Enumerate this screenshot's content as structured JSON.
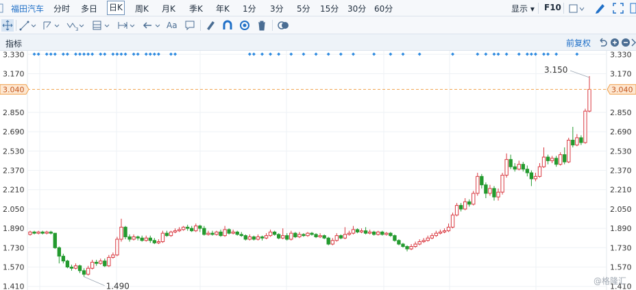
{
  "toolbar": {
    "stock_name": "福田汽车",
    "periods": [
      "分时",
      "多日",
      "日K",
      "周K",
      "月K",
      "季K",
      "年K",
      "1分",
      "3分",
      "5分",
      "15分",
      "30分",
      "60分"
    ],
    "selected_period": "日K",
    "display_label": "显示",
    "f10_label": "F10",
    "text_tool": "Aa"
  },
  "indicator_bar": {
    "label": "指标",
    "adjust_label": "前复权"
  },
  "colors": {
    "up": "#d9363e",
    "down": "#239a2e",
    "accent": "#1f6fc7",
    "price_line": "#f0a04b",
    "marker": "#2f8be0"
  },
  "watermark": "@格隆汇",
  "chart_data": {
    "type": "candlestick",
    "title": "",
    "y_ticks": [
      "3.330",
      "3.170",
      "3.040",
      "2.850",
      "2.690",
      "2.530",
      "2.370",
      "2.210",
      "2.050",
      "1.890",
      "1.730",
      "1.570",
      "1.410"
    ],
    "ylim": [
      1.38,
      3.36
    ],
    "current_price": "3.040",
    "annotations": {
      "max": "3.150",
      "min": "1.490"
    },
    "candles": [
      [
        1.84,
        1.86,
        1.87,
        1.83
      ],
      [
        1.86,
        1.85,
        1.87,
        1.84
      ],
      [
        1.85,
        1.86,
        1.87,
        1.84
      ],
      [
        1.86,
        1.85,
        1.87,
        1.84
      ],
      [
        1.85,
        1.86,
        1.87,
        1.84
      ],
      [
        1.86,
        1.85,
        1.87,
        1.84
      ],
      [
        1.85,
        1.73,
        1.85,
        1.72
      ],
      [
        1.73,
        1.66,
        1.74,
        1.6
      ],
      [
        1.66,
        1.62,
        1.68,
        1.6
      ],
      [
        1.62,
        1.57,
        1.63,
        1.56
      ],
      [
        1.57,
        1.56,
        1.59,
        1.54
      ],
      [
        1.56,
        1.58,
        1.6,
        1.55
      ],
      [
        1.58,
        1.54,
        1.59,
        1.52
      ],
      [
        1.54,
        1.51,
        1.56,
        1.49
      ],
      [
        1.51,
        1.56,
        1.58,
        1.5
      ],
      [
        1.56,
        1.61,
        1.63,
        1.55
      ],
      [
        1.61,
        1.6,
        1.63,
        1.58
      ],
      [
        1.6,
        1.62,
        1.64,
        1.59
      ],
      [
        1.62,
        1.58,
        1.64,
        1.57
      ],
      [
        1.58,
        1.65,
        1.67,
        1.57
      ],
      [
        1.65,
        1.67,
        1.69,
        1.64
      ],
      [
        1.67,
        1.8,
        1.82,
        1.66
      ],
      [
        1.8,
        1.9,
        1.97,
        1.78
      ],
      [
        1.9,
        1.82,
        1.91,
        1.8
      ],
      [
        1.82,
        1.8,
        1.84,
        1.78
      ],
      [
        1.8,
        1.82,
        1.84,
        1.79
      ],
      [
        1.82,
        1.81,
        1.83,
        1.79
      ],
      [
        1.81,
        1.79,
        1.83,
        1.78
      ],
      [
        1.79,
        1.81,
        1.83,
        1.78
      ],
      [
        1.81,
        1.79,
        1.83,
        1.77
      ],
      [
        1.79,
        1.77,
        1.81,
        1.76
      ],
      [
        1.77,
        1.78,
        1.8,
        1.76
      ],
      [
        1.78,
        1.85,
        1.87,
        1.77
      ],
      [
        1.85,
        1.83,
        1.87,
        1.82
      ],
      [
        1.83,
        1.86,
        1.87,
        1.82
      ],
      [
        1.86,
        1.87,
        1.89,
        1.85
      ],
      [
        1.87,
        1.88,
        1.9,
        1.86
      ],
      [
        1.88,
        1.9,
        1.91,
        1.87
      ],
      [
        1.9,
        1.89,
        1.92,
        1.87
      ],
      [
        1.89,
        1.87,
        1.91,
        1.86
      ],
      [
        1.87,
        1.91,
        1.93,
        1.86
      ],
      [
        1.91,
        1.89,
        1.92,
        1.86
      ],
      [
        1.89,
        1.84,
        1.91,
        1.83
      ],
      [
        1.84,
        1.85,
        1.87,
        1.83
      ],
      [
        1.85,
        1.84,
        1.87,
        1.83
      ],
      [
        1.84,
        1.86,
        1.87,
        1.83
      ],
      [
        1.86,
        1.83,
        1.88,
        1.82
      ],
      [
        1.83,
        1.88,
        1.91,
        1.82
      ],
      [
        1.88,
        1.85,
        1.89,
        1.84
      ],
      [
        1.85,
        1.86,
        1.88,
        1.84
      ],
      [
        1.86,
        1.84,
        1.87,
        1.83
      ],
      [
        1.84,
        1.83,
        1.86,
        1.82
      ],
      [
        1.83,
        1.8,
        1.84,
        1.79
      ],
      [
        1.8,
        1.82,
        1.84,
        1.79
      ],
      [
        1.82,
        1.8,
        1.83,
        1.79
      ],
      [
        1.8,
        1.82,
        1.84,
        1.79
      ],
      [
        1.82,
        1.81,
        1.83,
        1.79
      ],
      [
        1.81,
        1.83,
        1.85,
        1.8
      ],
      [
        1.83,
        1.86,
        1.88,
        1.82
      ],
      [
        1.86,
        1.84,
        1.87,
        1.83
      ],
      [
        1.84,
        1.81,
        1.85,
        1.8
      ],
      [
        1.81,
        1.83,
        1.89,
        1.8
      ],
      [
        1.83,
        1.8,
        1.85,
        1.79
      ],
      [
        1.8,
        1.85,
        1.87,
        1.79
      ],
      [
        1.85,
        1.82,
        1.86,
        1.81
      ],
      [
        1.82,
        1.84,
        1.86,
        1.81
      ],
      [
        1.84,
        1.83,
        1.85,
        1.82
      ],
      [
        1.83,
        1.85,
        1.86,
        1.82
      ],
      [
        1.85,
        1.84,
        1.86,
        1.83
      ],
      [
        1.84,
        1.82,
        1.85,
        1.81
      ],
      [
        1.82,
        1.83,
        1.85,
        1.81
      ],
      [
        1.83,
        1.81,
        1.84,
        1.8
      ],
      [
        1.81,
        1.76,
        1.82,
        1.75
      ],
      [
        1.76,
        1.79,
        1.81,
        1.75
      ],
      [
        1.79,
        1.83,
        1.85,
        1.78
      ],
      [
        1.83,
        1.81,
        1.84,
        1.8
      ],
      [
        1.81,
        1.84,
        1.9,
        1.8
      ],
      [
        1.84,
        1.85,
        1.87,
        1.83
      ],
      [
        1.85,
        1.88,
        1.91,
        1.84
      ],
      [
        1.88,
        1.86,
        1.89,
        1.85
      ],
      [
        1.86,
        1.87,
        1.89,
        1.85
      ],
      [
        1.87,
        1.85,
        1.9,
        1.84
      ],
      [
        1.85,
        1.86,
        1.88,
        1.84
      ],
      [
        1.86,
        1.84,
        1.87,
        1.83
      ],
      [
        1.84,
        1.86,
        1.87,
        1.83
      ],
      [
        1.86,
        1.84,
        1.87,
        1.83
      ],
      [
        1.84,
        1.85,
        1.86,
        1.83
      ],
      [
        1.85,
        1.83,
        1.86,
        1.82
      ],
      [
        1.83,
        1.79,
        1.84,
        1.78
      ],
      [
        1.79,
        1.76,
        1.8,
        1.75
      ],
      [
        1.76,
        1.74,
        1.77,
        1.73
      ],
      [
        1.74,
        1.72,
        1.75,
        1.7
      ],
      [
        1.72,
        1.74,
        1.76,
        1.71
      ],
      [
        1.74,
        1.76,
        1.78,
        1.73
      ],
      [
        1.76,
        1.78,
        1.8,
        1.75
      ],
      [
        1.78,
        1.79,
        1.81,
        1.77
      ],
      [
        1.79,
        1.81,
        1.83,
        1.78
      ],
      [
        1.81,
        1.83,
        1.85,
        1.8
      ],
      [
        1.83,
        1.85,
        1.87,
        1.82
      ],
      [
        1.85,
        1.86,
        1.88,
        1.84
      ],
      [
        1.86,
        1.87,
        1.89,
        1.85
      ],
      [
        1.87,
        1.9,
        1.93,
        1.86
      ],
      [
        1.9,
        2.0,
        2.02,
        1.89
      ],
      [
        2.0,
        2.08,
        2.1,
        1.99
      ],
      [
        2.08,
        2.05,
        2.1,
        2.03
      ],
      [
        2.05,
        2.11,
        2.14,
        2.04
      ],
      [
        2.11,
        2.09,
        2.13,
        2.07
      ],
      [
        2.09,
        2.18,
        2.2,
        2.08
      ],
      [
        2.18,
        2.32,
        2.35,
        2.16
      ],
      [
        2.32,
        2.25,
        2.34,
        2.22
      ],
      [
        2.25,
        2.18,
        2.27,
        2.14
      ],
      [
        2.18,
        2.22,
        2.25,
        2.16
      ],
      [
        2.22,
        2.15,
        2.24,
        2.12
      ],
      [
        2.15,
        2.19,
        2.22,
        2.12
      ],
      [
        2.19,
        2.33,
        2.35,
        2.17
      ],
      [
        2.33,
        2.46,
        2.51,
        2.31
      ],
      [
        2.46,
        2.4,
        2.5,
        2.38
      ],
      [
        2.4,
        2.38,
        2.43,
        2.36
      ],
      [
        2.38,
        2.42,
        2.45,
        2.37
      ],
      [
        2.42,
        2.38,
        2.44,
        2.36
      ],
      [
        2.38,
        2.35,
        2.41,
        2.32
      ],
      [
        2.35,
        2.3,
        2.37,
        2.24
      ],
      [
        2.3,
        2.32,
        2.35,
        2.28
      ],
      [
        2.32,
        2.4,
        2.43,
        2.31
      ],
      [
        2.4,
        2.48,
        2.56,
        2.39
      ],
      [
        2.48,
        2.45,
        2.5,
        2.42
      ],
      [
        2.45,
        2.47,
        2.49,
        2.43
      ],
      [
        2.47,
        2.42,
        2.49,
        2.4
      ],
      [
        2.42,
        2.5,
        2.52,
        2.41
      ],
      [
        2.5,
        2.44,
        2.56,
        2.42
      ],
      [
        2.44,
        2.62,
        2.64,
        2.43
      ],
      [
        2.62,
        2.58,
        2.73,
        2.56
      ],
      [
        2.58,
        2.64,
        2.67,
        2.57
      ],
      [
        2.64,
        2.6,
        2.66,
        2.58
      ],
      [
        2.6,
        2.86,
        2.88,
        2.59
      ],
      [
        2.86,
        3.04,
        3.15,
        2.85
      ]
    ],
    "signal_markers": [
      1,
      2,
      4,
      5,
      6,
      8,
      9,
      11,
      12,
      13,
      14,
      15,
      17,
      18,
      20,
      21,
      22,
      23,
      25,
      26,
      28,
      29,
      30,
      31,
      34,
      35,
      53,
      54,
      56,
      58,
      60,
      63,
      66,
      69,
      72,
      75,
      78,
      83,
      87,
      90,
      94,
      102,
      108,
      110,
      112,
      113,
      115,
      118,
      120,
      121,
      122,
      124,
      125,
      127,
      132
    ]
  }
}
